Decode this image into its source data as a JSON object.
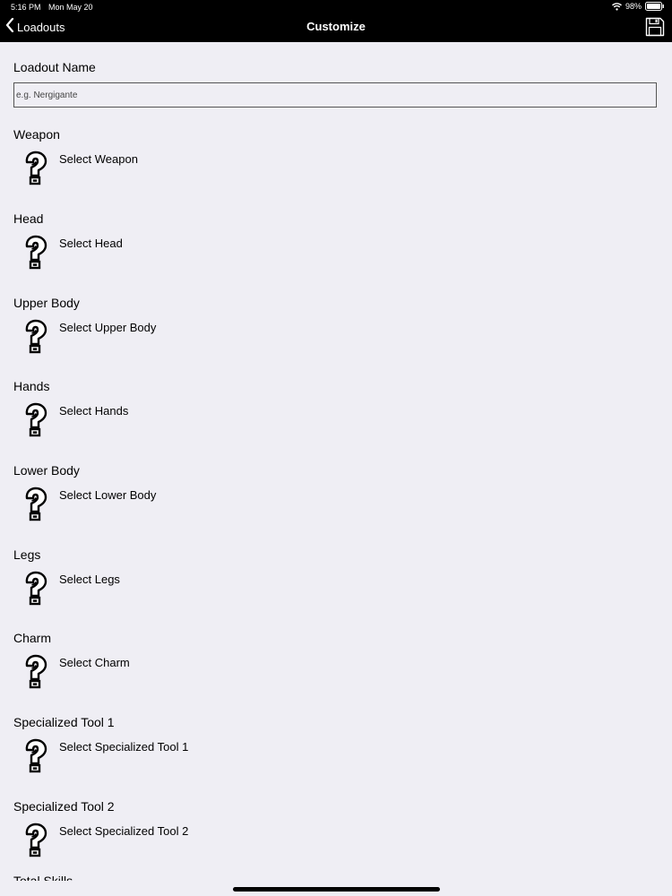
{
  "status_bar": {
    "time": "5:16 PM",
    "date": "Mon May 20",
    "battery": "98%"
  },
  "nav": {
    "back_label": "Loadouts",
    "title": "Customize"
  },
  "loadout_name": {
    "label": "Loadout Name",
    "placeholder": "e.g. Nergigante",
    "value": ""
  },
  "slots": [
    {
      "label": "Weapon",
      "action": "Select Weapon"
    },
    {
      "label": "Head",
      "action": "Select Head"
    },
    {
      "label": "Upper Body",
      "action": "Select Upper Body"
    },
    {
      "label": "Hands",
      "action": "Select Hands"
    },
    {
      "label": "Lower Body",
      "action": "Select Lower Body"
    },
    {
      "label": "Legs",
      "action": "Select Legs"
    },
    {
      "label": "Charm",
      "action": "Select Charm"
    },
    {
      "label": "Specialized Tool 1",
      "action": "Select Specialized Tool 1"
    },
    {
      "label": "Specialized Tool 2",
      "action": "Select Specialized Tool 2"
    }
  ],
  "total_skills_label": "Total Skills",
  "colors": {
    "background": "#efeef4",
    "bar": "#000000"
  }
}
